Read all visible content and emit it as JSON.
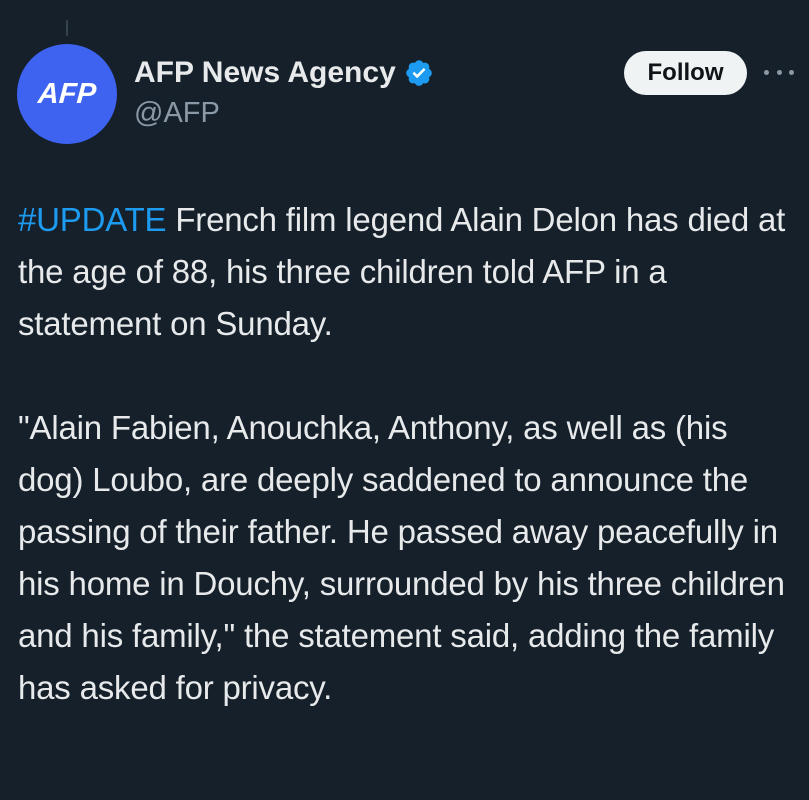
{
  "author": {
    "avatar_text": "AFP",
    "display_name": "AFP News Agency",
    "handle": "@AFP",
    "verified_icon": "verified-badge-icon",
    "avatar_color": "#3d63f0"
  },
  "actions": {
    "follow_label": "Follow",
    "more_icon": "more-horizontal-icon"
  },
  "tweet": {
    "hashtag": "#UPDATE",
    "paragraph1_rest": " French film legend Alain Delon has died at the age of 88, his three children told AFP in a statement on Sunday.",
    "paragraph2": "\"Alain Fabien, Anouchka, Anthony, as well as (his dog) Loubo, are deeply saddened to announce the passing of their father. He passed away peacefully in his home in Douchy, surrounded by his three children and his family,\" the statement said, adding the family has asked for privacy."
  },
  "colors": {
    "background": "#15202b",
    "text": "#e7e9ea",
    "secondary_text": "#8b98a5",
    "link": "#1d9bf0",
    "follow_bg": "#eff3f4"
  }
}
